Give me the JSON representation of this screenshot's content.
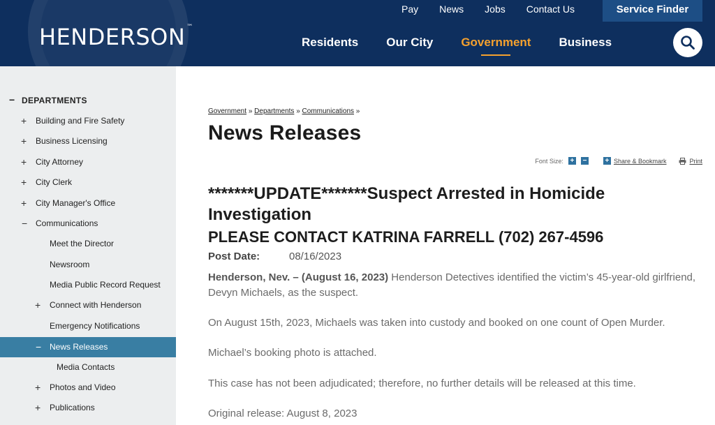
{
  "header": {
    "logo_text": "HENDERSON",
    "logo_tm": "™",
    "top_links": [
      "Pay",
      "News",
      "Jobs",
      "Contact Us"
    ],
    "service_finder": "Service Finder",
    "main_nav": [
      {
        "label": "Residents",
        "active": false
      },
      {
        "label": "Our City",
        "active": false
      },
      {
        "label": "Government",
        "active": true
      },
      {
        "label": "Business",
        "active": false
      }
    ],
    "search_icon": "search-icon",
    "colors": {
      "header_bg": "#0e2f5e",
      "accent": "#f5a12e",
      "service_finder_bg": "#1d4e85"
    }
  },
  "sidebar": {
    "heading": "DEPARTMENTS",
    "heading_symbol": "−",
    "items": [
      {
        "label": "Building and Fire Safety",
        "symbol": "+"
      },
      {
        "label": "Business Licensing",
        "symbol": "+"
      },
      {
        "label": "City Attorney",
        "symbol": "+"
      },
      {
        "label": "City Clerk",
        "symbol": "+"
      },
      {
        "label": "City Manager's Office",
        "symbol": "+"
      },
      {
        "label": "Communications",
        "symbol": "−"
      },
      {
        "label": "Meet the Director",
        "symbol": ""
      },
      {
        "label": "Newsroom",
        "symbol": ""
      },
      {
        "label": "Media Public Record Request",
        "symbol": ""
      },
      {
        "label": "Connect with Henderson",
        "symbol": "+"
      },
      {
        "label": "Emergency Notifications",
        "symbol": ""
      },
      {
        "label": "News Releases",
        "symbol": "−",
        "active": true
      },
      {
        "label": "Media Contacts",
        "symbol": ""
      },
      {
        "label": "Photos and Video",
        "symbol": "+"
      },
      {
        "label": "Publications",
        "symbol": "+"
      }
    ],
    "active_color": "#397ea3"
  },
  "content": {
    "breadcrumb": [
      "Government",
      "Communications",
      "Departments"
    ],
    "breadcrumb_sep": "»",
    "title": "News Releases",
    "tools": {
      "font_size_label": "Font Size:",
      "increase": "+",
      "decrease": "−",
      "share_icon": "+",
      "share_label": "Share & Bookmark",
      "print_label": "Print"
    },
    "headline": "*******UPDATE*******Suspect Arrested in Homicide Investigation",
    "contact": "PLEASE CONTACT KATRINA FARRELL (702) 267-4596",
    "post_date_label": "Post Date:",
    "post_date_value": "08/16/2023",
    "dateline": "Henderson, Nev. – (August 16, 2023)",
    "paragraph1_rest": " Henderson Detectives identified the victim’s 45-year-old girlfriend, Devyn Michaels, as the suspect.",
    "paragraph2": "On August 15th, 2023, Michaels was taken into custody and booked on one count of Open Murder.",
    "paragraph3": "Michael’s booking photo is attached.",
    "paragraph4": "This case has not been adjudicated; therefore, no further details will be released at this time.",
    "paragraph5": "Original release: August 8, 2023"
  }
}
